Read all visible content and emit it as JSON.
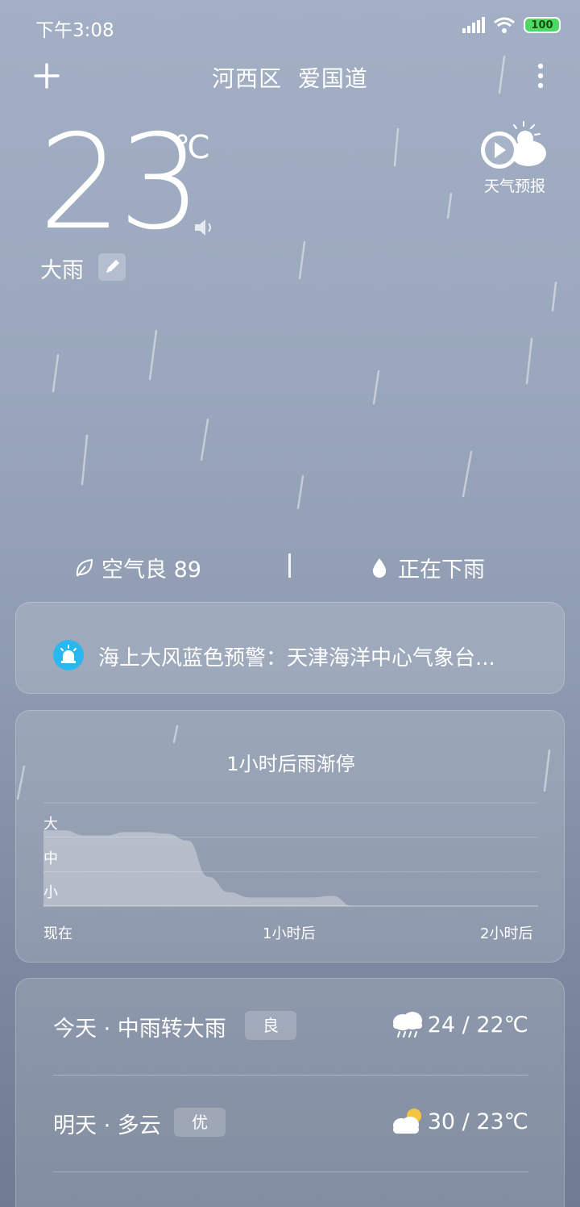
{
  "status_bar": {
    "time": "下午3:08",
    "battery": "100"
  },
  "header": {
    "location": "河西区  爱国道"
  },
  "current": {
    "temperature": "23",
    "unit": "℃",
    "condition": "大雨",
    "forecast_video_label": "天气预报"
  },
  "summary": {
    "air_quality": "空气良 89",
    "precip_status": "正在下雨"
  },
  "alert": {
    "text": "海上大风蓝色预警：天津海洋中心气象台..."
  },
  "precip_chart": {
    "title": "1小时后雨渐停",
    "levels": [
      "大",
      "中",
      "小"
    ],
    "time_labels": [
      "现在",
      "1小时后",
      "2小时后"
    ]
  },
  "chart_data": {
    "type": "area",
    "title": "1小时后雨渐停",
    "x_labels": [
      "现在",
      "1小时后",
      "2小时后"
    ],
    "y_levels": [
      "小",
      "中",
      "大"
    ],
    "x_minutes": [
      0,
      5,
      10,
      15,
      20,
      25,
      30,
      35,
      40,
      45,
      50,
      55,
      60,
      65,
      70,
      75,
      80,
      85,
      90,
      95,
      100,
      105,
      110,
      115,
      120
    ],
    "values": [
      2.2,
      2.2,
      2.05,
      2.05,
      2.15,
      2.15,
      2.1,
      1.9,
      0.85,
      0.4,
      0.25,
      0.25,
      0.25,
      0.25,
      0.3,
      0.0,
      0,
      0,
      0,
      0,
      0,
      0,
      0,
      0,
      0
    ],
    "ylim": [
      0,
      3
    ]
  },
  "daily": [
    {
      "day": "今天 · 中雨转大雨",
      "aqi": "良",
      "icon": "rain-icon",
      "temp": "24 / 22℃"
    },
    {
      "day": "明天 · 多云",
      "aqi": "优",
      "icon": "partly-cloudy-icon",
      "temp": "30 / 23℃"
    }
  ]
}
